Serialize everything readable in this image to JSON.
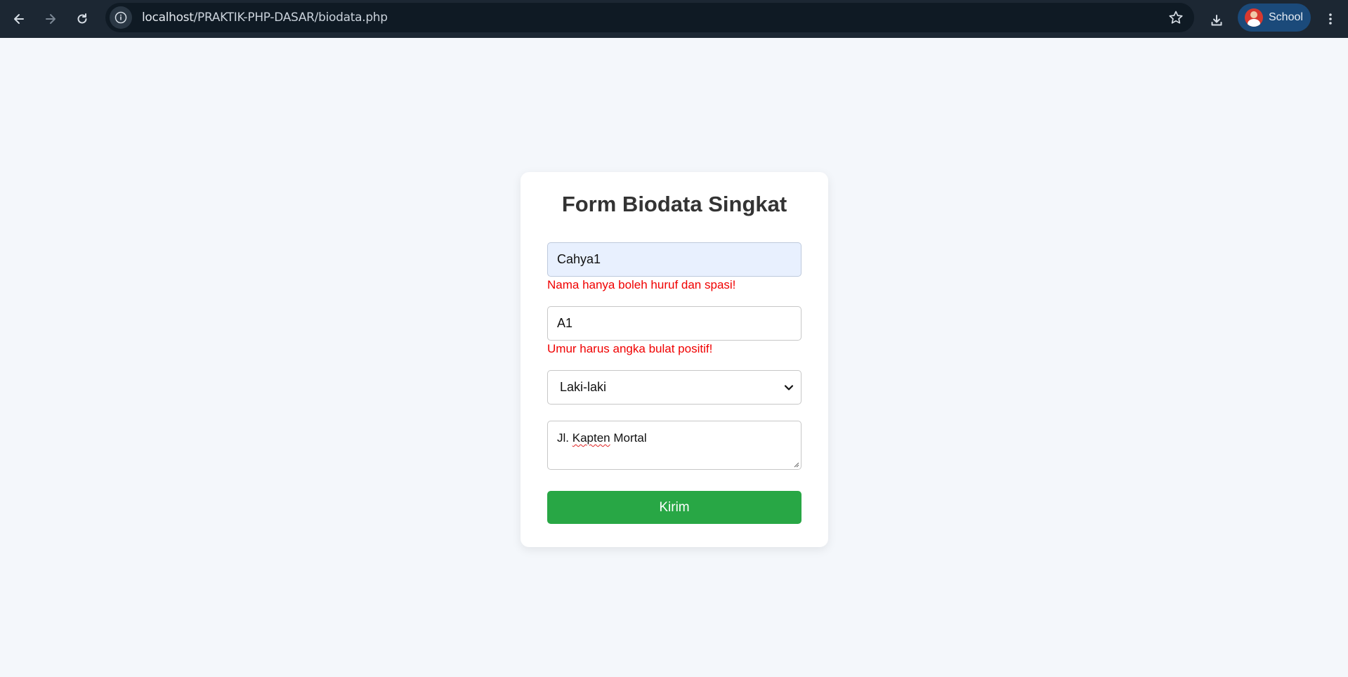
{
  "browser": {
    "url_host": "localhost",
    "url_path": "/PRAKTIK-PHP-DASAR/biodata.php",
    "profile_name": "School",
    "icons": {
      "back": "back-arrow-icon",
      "forward": "forward-arrow-icon",
      "reload": "reload-icon",
      "site_info": "info-icon",
      "bookmark": "star-icon",
      "download": "download-icon",
      "menu": "kebab-menu-icon"
    }
  },
  "form": {
    "title": "Form Biodata Singkat",
    "name_value": "Cahya1",
    "name_error": "Nama hanya boleh huruf dan spasi!",
    "age_value": "A1",
    "age_error": "Umur harus angka bulat positif!",
    "gender_selected": "Laki-laki",
    "address_word1": "Jl.",
    "address_word2": "Kapten",
    "address_word3": "Mortal",
    "submit_label": "Kirim"
  },
  "colors": {
    "toolbar": "#1c2733",
    "page_bg": "#f4f7fb",
    "error": "#f00000",
    "submit": "#28a745",
    "autofill_bg": "#e8f0fe"
  }
}
